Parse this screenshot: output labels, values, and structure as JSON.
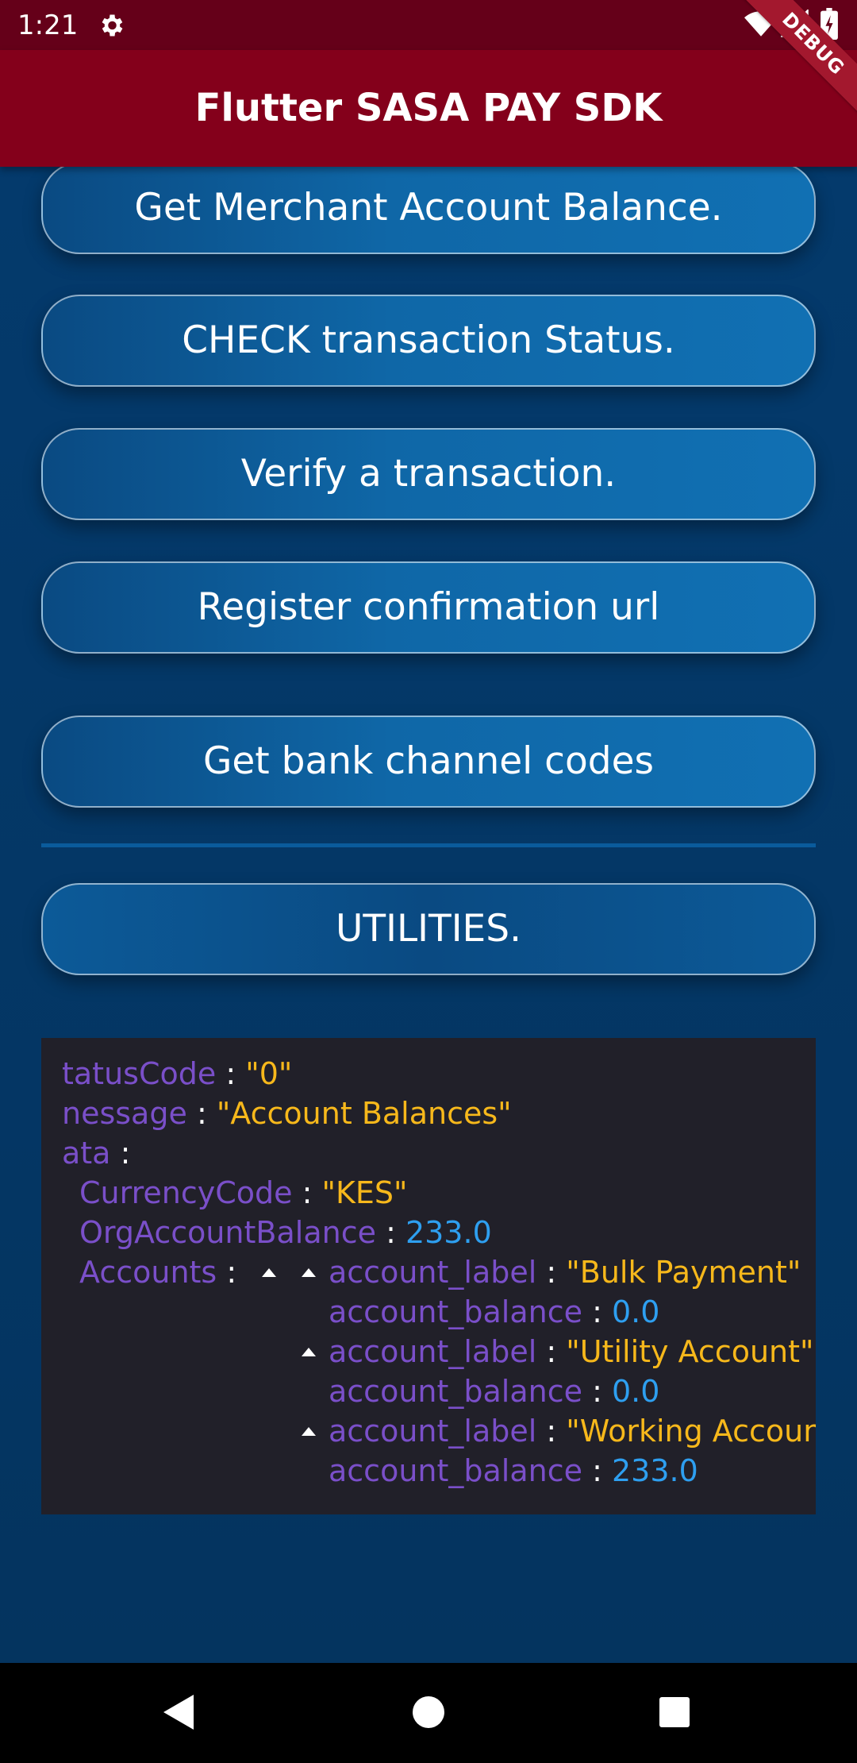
{
  "status_bar": {
    "time": "1:21",
    "icons": [
      "gear-icon",
      "wifi-icon",
      "signal-icon",
      "battery-icon"
    ]
  },
  "app_bar": {
    "title": "Flutter SASA PAY SDK",
    "debug_banner": "DEBUG"
  },
  "buttons": {
    "merchant_balance": "Get Merchant Account Balance.",
    "check_status": "CHECK transaction Status.",
    "verify": "Verify a transaction.",
    "register_url": "Register confirmation url",
    "bank_codes": "Get bank channel codes",
    "utilities": "UTILITIES."
  },
  "json_view": {
    "status_code_key": "tatusCode",
    "status_code_value": "\"0\"",
    "message_key": "nessage",
    "message_value": "\"Account Balances\"",
    "data_key": "ata",
    "currency_key": "CurrencyCode",
    "currency_value": "\"KES\"",
    "org_balance_key": "OrgAccountBalance",
    "org_balance_value": "233.0",
    "accounts_key": "Accounts",
    "accounts": [
      {
        "label_key": "account_label",
        "label_value": "\"Bulk Payment\"",
        "balance_key": "account_balance",
        "balance_value": "0.0"
      },
      {
        "label_key": "account_label",
        "label_value": "\"Utility Account\"",
        "balance_key": "account_balance",
        "balance_value": "0.0"
      },
      {
        "label_key": "account_label",
        "label_value": "\"Working Account\"",
        "balance_key": "account_balance",
        "balance_value": "233.0"
      }
    ],
    "colors": {
      "key": "#7a4fc9",
      "string": "#f7b81b",
      "number": "#2e9ff0",
      "background": "#212029"
    }
  },
  "nav_bar": {
    "icons": [
      "back-icon",
      "home-icon",
      "recents-icon"
    ]
  },
  "theme": {
    "status_bar": "#650019",
    "app_bar": "#84001b",
    "background": "#043767",
    "button": "#0f67a7"
  }
}
